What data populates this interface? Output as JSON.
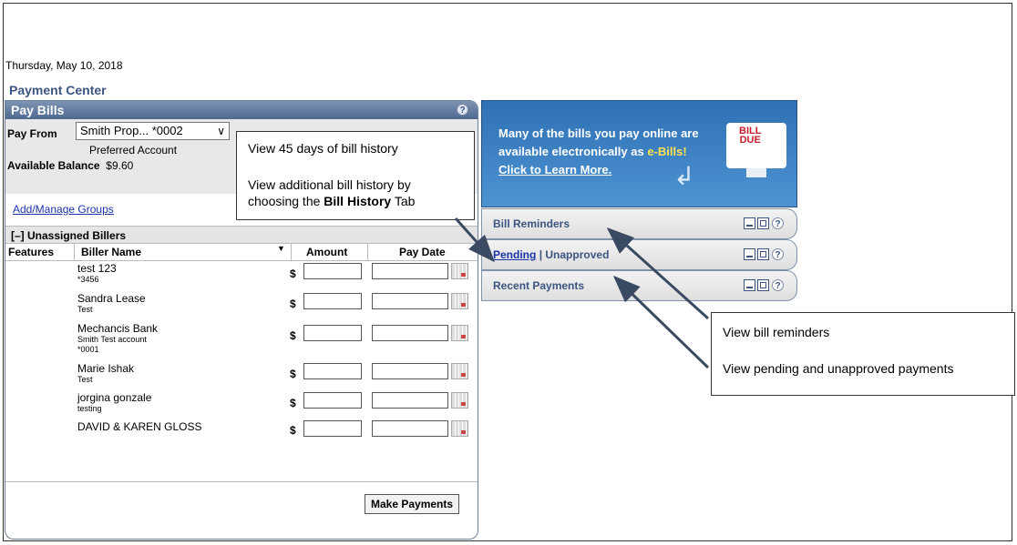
{
  "date": "Thursday, May 10, 2018",
  "page_title": "Payment Center",
  "pay_bills": {
    "title": "Pay Bills",
    "help": "?",
    "pay_from_label": "Pay From",
    "pay_from_value": "Smith Prop... *0002",
    "account_type": "Preferred Account",
    "available_label": "Available Balance",
    "available_value": "$9.60",
    "manage_groups": "Add/Manage Groups",
    "unassigned": "[–]  Unassigned Billers",
    "columns": {
      "features": "Features",
      "biller": "Biller Name",
      "amount": "Amount",
      "pay_date": "Pay Date"
    },
    "currency": "$",
    "billers": [
      {
        "name": "test 123",
        "sub1": "*3456",
        "sub2": ""
      },
      {
        "name": "Sandra Lease",
        "sub1": "Test",
        "sub2": ""
      },
      {
        "name": "Mechancis Bank",
        "sub1": "Smith Test account",
        "sub2": "*0001"
      },
      {
        "name": "Marie Ishak",
        "sub1": "Test",
        "sub2": ""
      },
      {
        "name": "jorgina gonzale",
        "sub1": "testing",
        "sub2": ""
      },
      {
        "name": "DAVID & KAREN GLOSS",
        "sub1": "",
        "sub2": ""
      }
    ],
    "make_payments": "Make Payments"
  },
  "callout_left": {
    "line1": "View 45 days of bill history",
    "line2a": "View additional bill history by",
    "line2b_pre": "choosing the ",
    "line2b_bold": "Bill History",
    "line2b_post": " Tab"
  },
  "ebill": {
    "line1": "Many of the bills you pay online are",
    "line2_pre": "available electronically as ",
    "line2_accent": "e-Bills!",
    "line3": "Click to Learn More.",
    "logo_line1": "BILL",
    "logo_line2": "DUE",
    "colors": {
      "panel": "#3a80c4",
      "accent": "#ffe04d",
      "logo_red": "#c41d2b"
    }
  },
  "panels": {
    "bill_reminders": "Bill Reminders",
    "pending": "Pending",
    "separator": "|",
    "unapproved": "Unapproved",
    "recent_payments": "Recent Payments"
  },
  "callout_right": {
    "line1": "View bill reminders",
    "line2": "View pending and unapproved payments"
  }
}
